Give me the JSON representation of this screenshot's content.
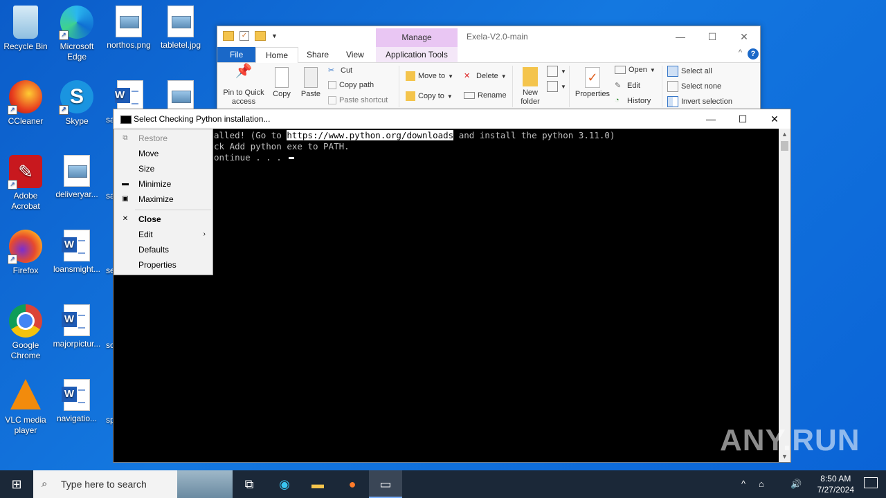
{
  "desktop": {
    "icons": [
      {
        "label": "Recycle Bin"
      },
      {
        "label": "Microsoft Edge"
      },
      {
        "label": "northos.png"
      },
      {
        "label": "tabletel.jpg"
      },
      {
        "label": "CCleaner"
      },
      {
        "label": "Skype"
      },
      {
        "label": "sa"
      },
      {
        "label": "Adobe Acrobat"
      },
      {
        "label": "deliveryar..."
      },
      {
        "label": "sa"
      },
      {
        "label": "Firefox"
      },
      {
        "label": "loansmight..."
      },
      {
        "label": "se"
      },
      {
        "label": "Google Chrome"
      },
      {
        "label": "majorpictur..."
      },
      {
        "label": "so"
      },
      {
        "label": "VLC media player"
      },
      {
        "label": "navigatio..."
      },
      {
        "label": "sp"
      }
    ]
  },
  "explorer": {
    "title": "Exela-V2.0-main",
    "manage_tab": "Manage",
    "tabs": [
      "File",
      "Home",
      "Share",
      "View",
      "Application Tools"
    ],
    "ribbon": {
      "pin": "Pin to Quick access",
      "copy": "Copy",
      "paste": "Paste",
      "cut": "Cut",
      "copy_path": "Copy path",
      "paste_shortcut": "Paste shortcut",
      "move_to": "Move to",
      "copy_to": "Copy to",
      "delete": "Delete",
      "rename": "Rename",
      "new_folder": "New folder",
      "properties": "Properties",
      "open": "Open",
      "edit": "Edit",
      "history": "History",
      "select_all": "Select all",
      "select_none": "Select none",
      "invert_selection": "Invert selection"
    }
  },
  "console": {
    "title": "Select Checking Python installation...",
    "lines": {
      "l1_pre": "alled! (Go to ",
      "l1_sel": "https://www.python.org/downloads",
      "l1_post": " and install the python 3.11.0)",
      "l2": "ck Add python exe to PATH.",
      "l3": "ontinue . . . "
    }
  },
  "system_menu": {
    "items": [
      {
        "label": "Restore"
      },
      {
        "label": "Move"
      },
      {
        "label": "Size"
      },
      {
        "label": "Minimize"
      },
      {
        "label": "Maximize"
      },
      {
        "label": "Close"
      },
      {
        "label": "Edit"
      },
      {
        "label": "Defaults"
      },
      {
        "label": "Properties"
      }
    ]
  },
  "watermark": "ANY.RUN",
  "taskbar": {
    "search_placeholder": "Type here to search",
    "time": "8:50 AM",
    "date": "7/27/2024"
  }
}
